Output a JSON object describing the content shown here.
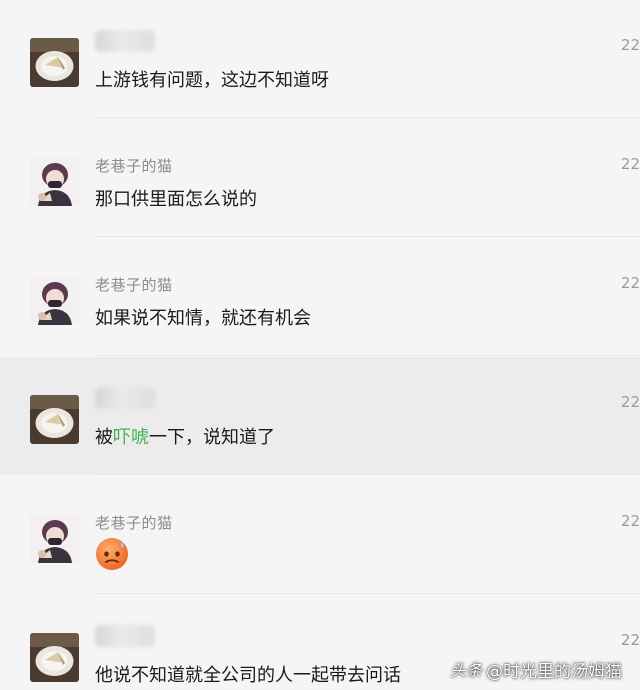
{
  "messages": [
    {
      "sender": "",
      "sender_blurred": true,
      "text": "上游钱有问题，这边不知道呀",
      "time": "22",
      "avatar": "plate-icon"
    },
    {
      "sender": "老巷子的猫",
      "sender_blurred": false,
      "text": "那口供里面怎么说的",
      "time": "22",
      "avatar": "masked-person-icon"
    },
    {
      "sender": "老巷子的猫",
      "sender_blurred": false,
      "text": "如果说不知情，就还有机会",
      "time": "22",
      "avatar": "masked-person-icon"
    },
    {
      "sender": "",
      "sender_blurred": true,
      "text_before": "被",
      "text_highlight": "吓唬",
      "text_after": "一下，说知道了",
      "time": "22",
      "avatar": "plate-icon"
    },
    {
      "sender": "老巷子的猫",
      "sender_blurred": false,
      "emoji": "sweat-face-emoji",
      "time": "22",
      "avatar": "masked-person-icon"
    },
    {
      "sender": "",
      "sender_blurred": true,
      "text": "他说不知道就全公司的人一起带去问话",
      "time": "22",
      "avatar": "plate-icon"
    }
  ],
  "colors": {
    "background": "#f5f5f5",
    "highlight_row": "#ececec",
    "keyword_green": "#3cb44b"
  },
  "watermark": {
    "brand": "头条",
    "handle": "@时光里的汤姆猫"
  }
}
